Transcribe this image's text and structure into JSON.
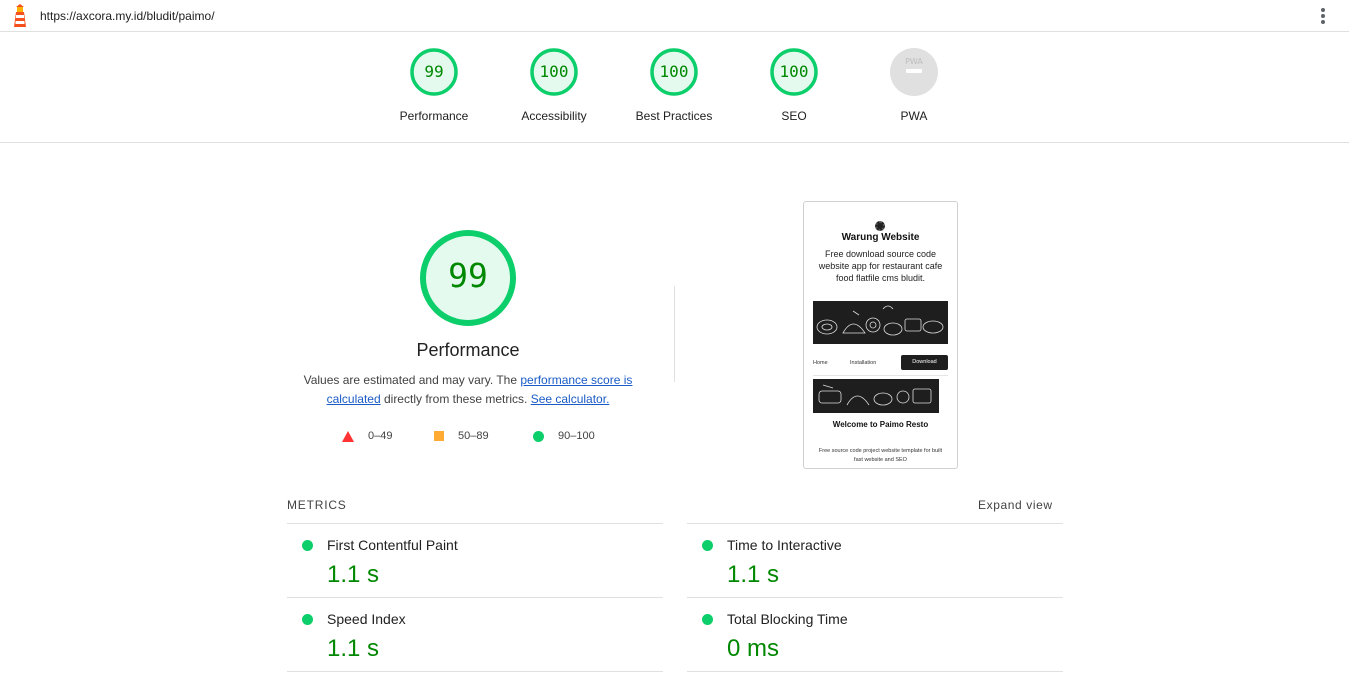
{
  "topbar": {
    "url": "https://axcora.my.id/bludit/paimo/",
    "logo_icon": "lighthouse-icon",
    "menu_icon": "kebab-menu-icon"
  },
  "gauges": [
    {
      "label": "Performance",
      "score": "99",
      "fraction": 0.99
    },
    {
      "label": "Accessibility",
      "score": "100",
      "fraction": 1.0
    },
    {
      "label": "Best Practices",
      "score": "100",
      "fraction": 1.0
    },
    {
      "label": "SEO",
      "score": "100",
      "fraction": 1.0
    },
    {
      "label": "PWA",
      "badge_text": "PWA",
      "icon": "pwa-badge-icon"
    }
  ],
  "performance": {
    "score": "99",
    "fraction": 0.99,
    "title": "Performance",
    "desc_part1": "Values are estimated and may vary. The ",
    "desc_link1": "performance score is calculated",
    "desc_part2": " directly from these metrics. ",
    "desc_link2": "See calculator."
  },
  "legend": [
    {
      "range": "0–49",
      "shape": "triangle",
      "color": "#ff3333"
    },
    {
      "range": "50–89",
      "shape": "square",
      "color": "#ffaa33"
    },
    {
      "range": "90–100",
      "shape": "circle",
      "color": "#0cce6b"
    }
  ],
  "screenshot": {
    "site_title": "Warung Website",
    "tagline": "Free download source code website app for restaurant cafe food flatfile cms bludit.",
    "nav_home": "Home",
    "nav_installation": "Installation",
    "nav_download": "Download",
    "welcome": "Welcome to Paimo Resto",
    "footer_text": "Free source code project website template for built fast website and SEO"
  },
  "metrics": {
    "header": "METRICS",
    "expand_label": "Expand view",
    "items": [
      {
        "name": "First Contentful Paint",
        "value": "1.1 s"
      },
      {
        "name": "Time to Interactive",
        "value": "1.1 s"
      },
      {
        "name": "Speed Index",
        "value": "1.1 s"
      },
      {
        "name": "Total Blocking Time",
        "value": "0 ms"
      }
    ]
  },
  "colors": {
    "pass": "#0cce6b",
    "pass_text": "#008800",
    "pass_fill": "#e5faef",
    "link": "#1a5bc6",
    "pwa_gray": "#e0e0e0"
  }
}
